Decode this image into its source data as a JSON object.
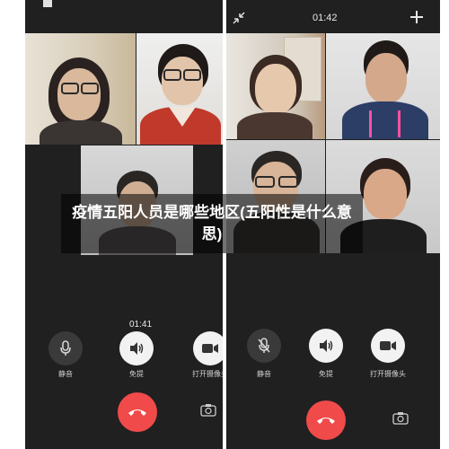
{
  "left_screen": {
    "timer": "01:41",
    "controls": [
      {
        "id": "mute",
        "label": "静音",
        "icon": "microphone-icon"
      },
      {
        "id": "speaker",
        "label": "免提",
        "icon": "speaker-icon"
      },
      {
        "id": "camera",
        "label": "打开摄像头",
        "icon": "video-camera-icon"
      }
    ],
    "hangup_icon": "phone-hangup-icon",
    "switch_camera_icon": "camera-switch-icon"
  },
  "right_screen": {
    "timer": "01:42",
    "minimize_icon": "shrink-arrows-icon",
    "add_icon": "plus-icon",
    "controls": [
      {
        "id": "mute",
        "label": "静音",
        "icon": "microphone-muted-icon"
      },
      {
        "id": "speaker",
        "label": "免提",
        "icon": "speaker-icon"
      },
      {
        "id": "camera",
        "label": "打开摄像头",
        "icon": "video-camera-icon"
      }
    ],
    "hangup_icon": "phone-hangup-icon",
    "switch_camera_icon": "camera-switch-icon"
  },
  "caption": {
    "text": "疫情五阳人员是哪些地区(五阳性是什么意思)"
  },
  "colors": {
    "hangup": "#f04a4a",
    "background": "#202020"
  }
}
